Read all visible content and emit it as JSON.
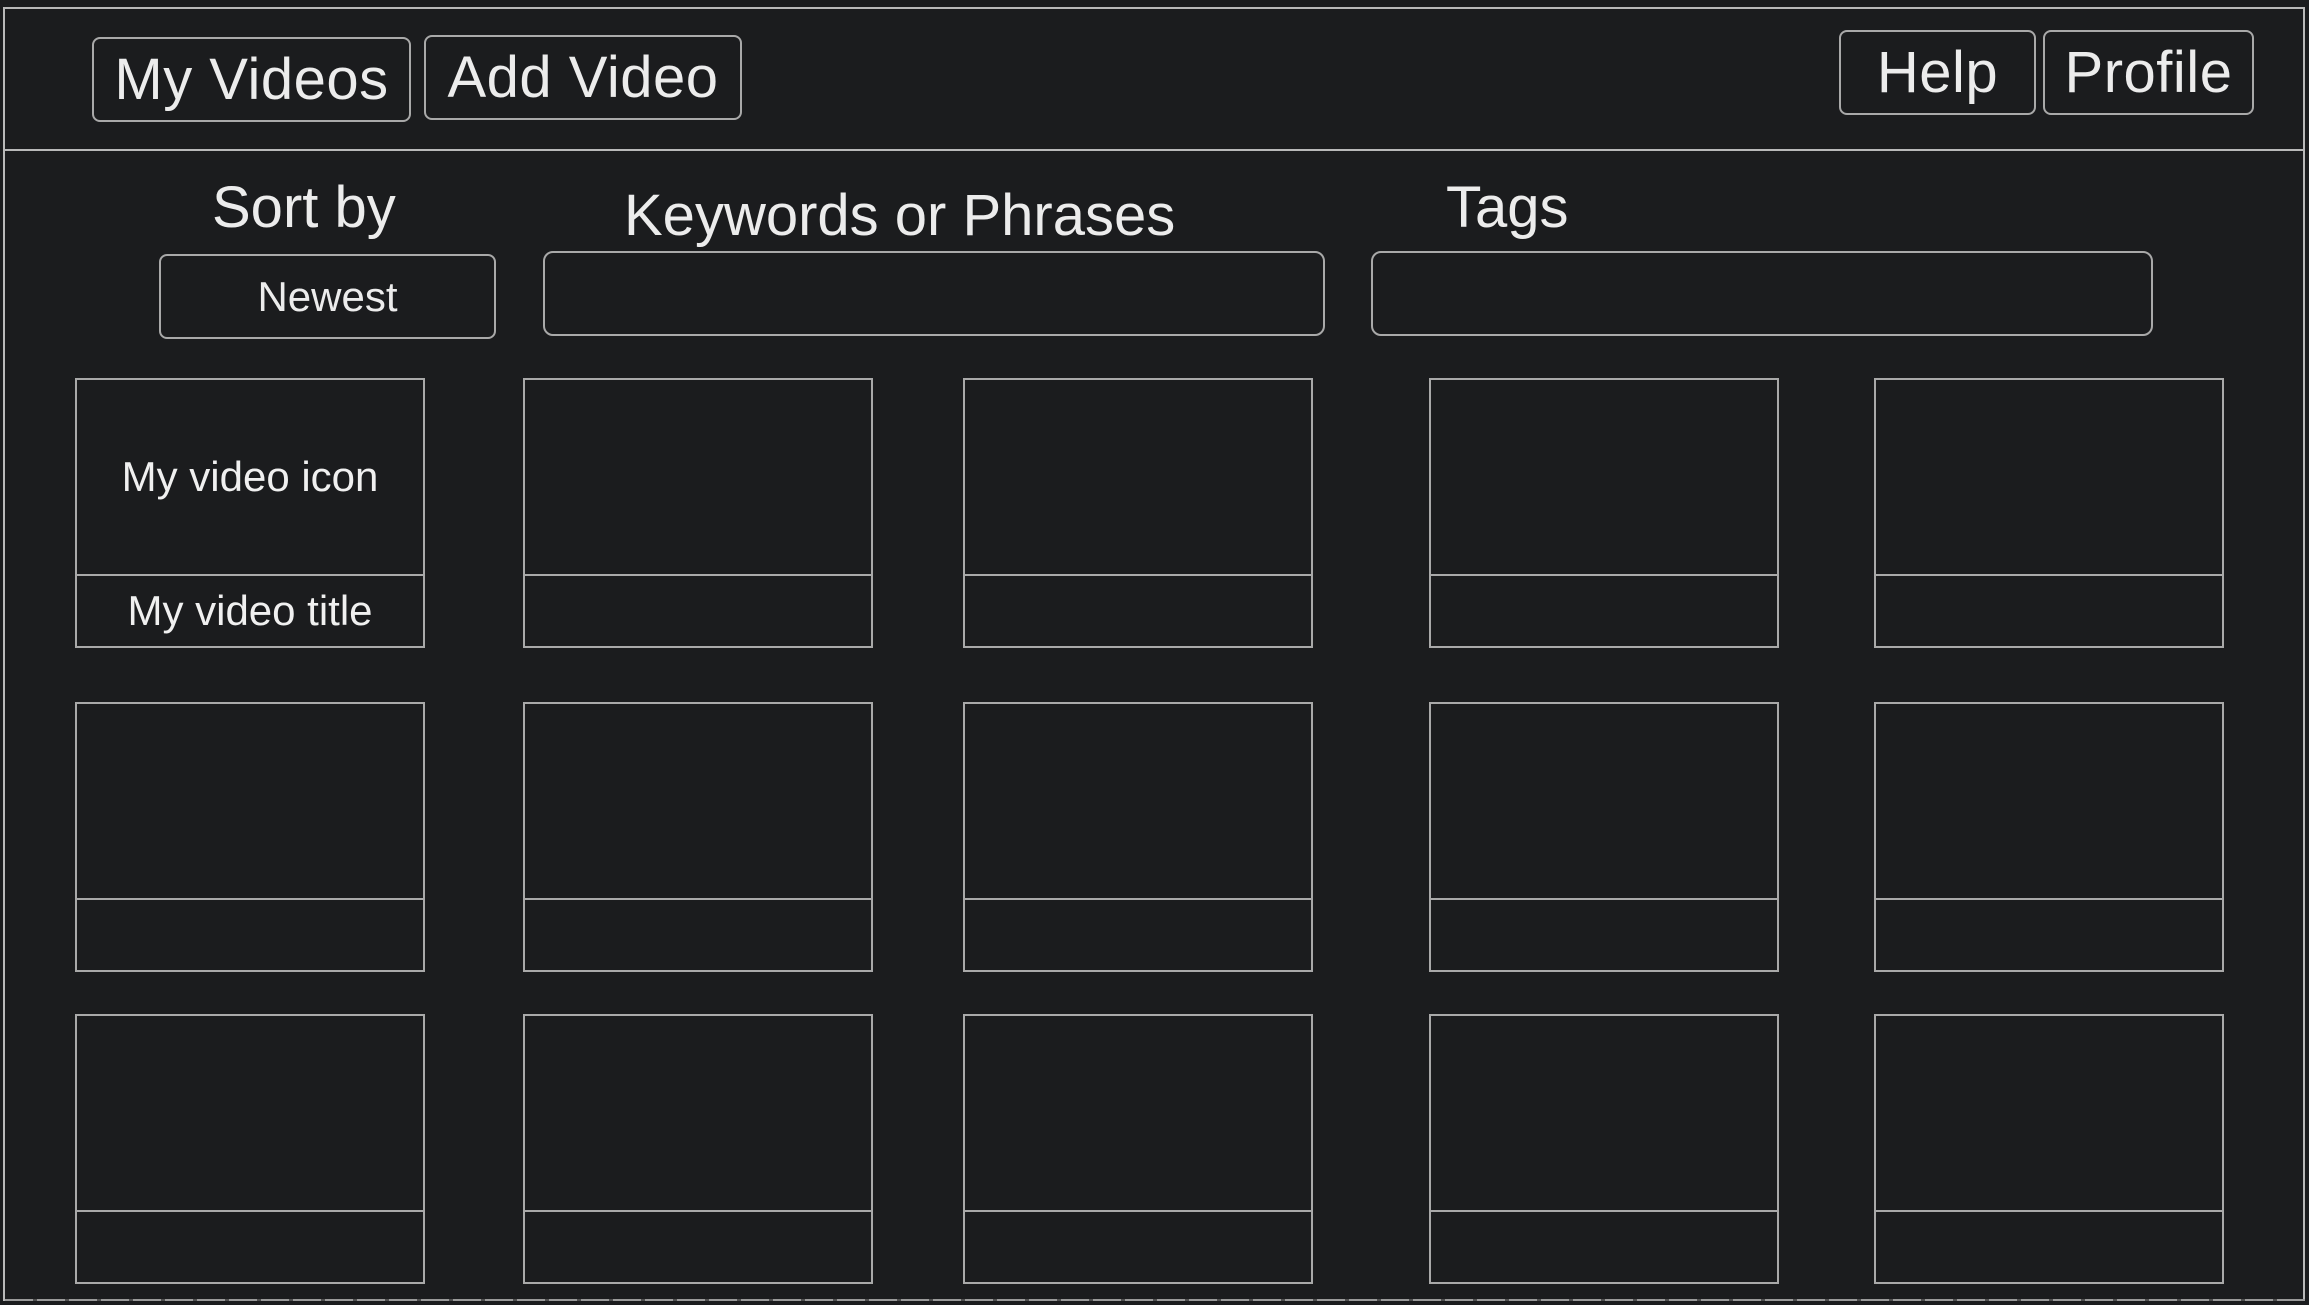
{
  "header": {
    "left_buttons": [
      {
        "label": "My Videos"
      },
      {
        "label": "Add Video"
      }
    ],
    "right_buttons": [
      {
        "label": "Help"
      },
      {
        "label": "Profile"
      }
    ]
  },
  "filters": {
    "sort": {
      "label": "Sort by",
      "value": "Newest"
    },
    "keywords": {
      "label": "Keywords or Phrases",
      "value": "",
      "placeholder": ""
    },
    "tags": {
      "label": "Tags",
      "value": "",
      "placeholder": ""
    }
  },
  "videos": [
    {
      "icon": "My video icon",
      "title": "My video title"
    },
    {
      "icon": "",
      "title": ""
    },
    {
      "icon": "",
      "title": ""
    },
    {
      "icon": "",
      "title": ""
    },
    {
      "icon": "",
      "title": ""
    },
    {
      "icon": "",
      "title": ""
    },
    {
      "icon": "",
      "title": ""
    },
    {
      "icon": "",
      "title": ""
    },
    {
      "icon": "",
      "title": ""
    },
    {
      "icon": "",
      "title": ""
    },
    {
      "icon": "",
      "title": ""
    },
    {
      "icon": "",
      "title": ""
    },
    {
      "icon": "",
      "title": ""
    },
    {
      "icon": "",
      "title": ""
    },
    {
      "icon": "",
      "title": ""
    }
  ]
}
